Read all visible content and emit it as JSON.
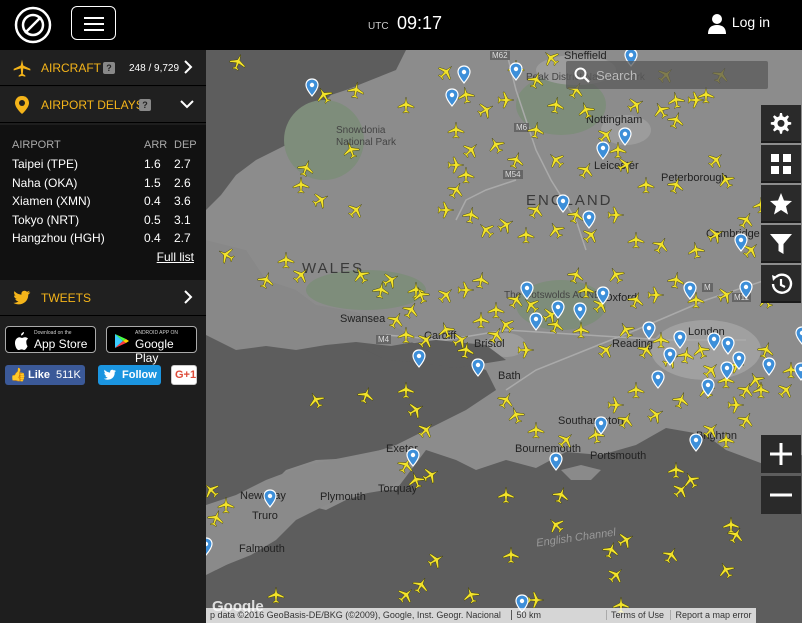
{
  "header": {
    "utc_label": "UTC",
    "time": "09:17",
    "login_label": "Log in"
  },
  "sidebar": {
    "aircraft": {
      "label": "AIRCRAFT",
      "count": "248 / 9,729"
    },
    "airport_delays": {
      "label": "AIRPORT DELAYS",
      "columns": [
        "AIRPORT",
        "ARR",
        "DEP"
      ],
      "rows": [
        [
          "Taipei (TPE)",
          "1.6",
          "2.7"
        ],
        [
          "Naha (OKA)",
          "1.5",
          "2.6"
        ],
        [
          "Xiamen (XMN)",
          "0.4",
          "3.6"
        ],
        [
          "Tokyo (NRT)",
          "0.5",
          "3.1"
        ],
        [
          "Hangzhou (HGH)",
          "0.4",
          "2.7"
        ]
      ],
      "full_list": "Full list"
    },
    "tweets": {
      "label": "TWEETS"
    },
    "app_store": {
      "small": "Download on the",
      "big": "App Store"
    },
    "google_play": {
      "small": "ANDROID APP ON",
      "big": "Google Play"
    },
    "facebook": {
      "label": "Like",
      "count": "511K"
    },
    "twitter": {
      "label": "Follow"
    },
    "gplus": {
      "label": "G+1"
    }
  },
  "map": {
    "search_placeholder": "Search",
    "labels": {
      "sheffield": "Sheffield",
      "peak": "Peak District National Park",
      "nottingham": "Nottingham",
      "snowdonia1": "Snowdonia",
      "snowdonia2": "National Park",
      "leicester": "Leicester",
      "peterborough": "Peterborough",
      "england": "ENGLAND",
      "cambridge": "Cambridge",
      "wales": "WALES",
      "cotswolds": "The Cotswolds AONB",
      "oxford": "Oxford",
      "swansea": "Swansea",
      "cardiff": "Cardiff",
      "london": "London",
      "bristol": "Bristol",
      "reading": "Reading",
      "bath": "Bath",
      "southampton": "Southampton",
      "brighton": "Brighton",
      "exeter": "Exeter",
      "portsmouth": "Portsmouth",
      "bournemouth": "Bournemouth",
      "torquay": "Torquay",
      "newquay": "Newquay",
      "plymouth": "Plymouth",
      "truro": "Truro",
      "falmouth": "Falmouth",
      "english_channel": "English Channel",
      "m62": "M62",
      "m6": "M6",
      "m54": "M54",
      "m4": "M4",
      "m11": "M11",
      "m": "M"
    },
    "attribution": "p data ©2016 GeoBasis-DE/BKG (©2009), Google, Inst. Geogr. Nacional",
    "scale": "50 km",
    "terms": "Terms of Use",
    "report": "Report a map error",
    "google_logo": "Google"
  },
  "colors": {
    "accent": "#f4b41a",
    "plane": "#f2e22b",
    "pin": "#3d8fd9",
    "land": "#8a8a8a",
    "sea": "#5d5d5d"
  }
}
